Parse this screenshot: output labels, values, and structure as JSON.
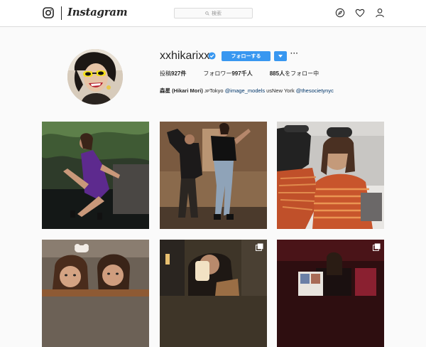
{
  "header": {
    "logo_text": "Instagram",
    "search_placeholder": "検索",
    "icons": [
      "instagram-glyph-icon",
      "search-icon",
      "compass-icon",
      "heart-icon",
      "user-icon"
    ]
  },
  "profile": {
    "username": "xxhikarixx",
    "verified": true,
    "follow_label": "フォローする",
    "more_label": "···",
    "stats": {
      "posts_label": "投稿",
      "posts_value": "927件",
      "followers_label": "フォロワー",
      "followers_value": "997千人",
      "following_value": "885人",
      "following_label": "をフォロー中"
    },
    "bio": {
      "name": "森星 (Hikari Mori)",
      "text1": " ᴊᴘTokyo ",
      "link1": "@image_models",
      "text2": " ᴜsNew York ",
      "link2": "@thesocietynyc"
    }
  },
  "colors": {
    "accent": "#3897f0",
    "link": "#003569",
    "border": "#dbdbdb",
    "background": "#fafafa"
  },
  "posts": [
    {
      "id": 1,
      "multi": false
    },
    {
      "id": 2,
      "multi": false
    },
    {
      "id": 3,
      "multi": false
    },
    {
      "id": 4,
      "multi": false
    },
    {
      "id": 5,
      "multi": true
    },
    {
      "id": 6,
      "multi": true
    }
  ]
}
